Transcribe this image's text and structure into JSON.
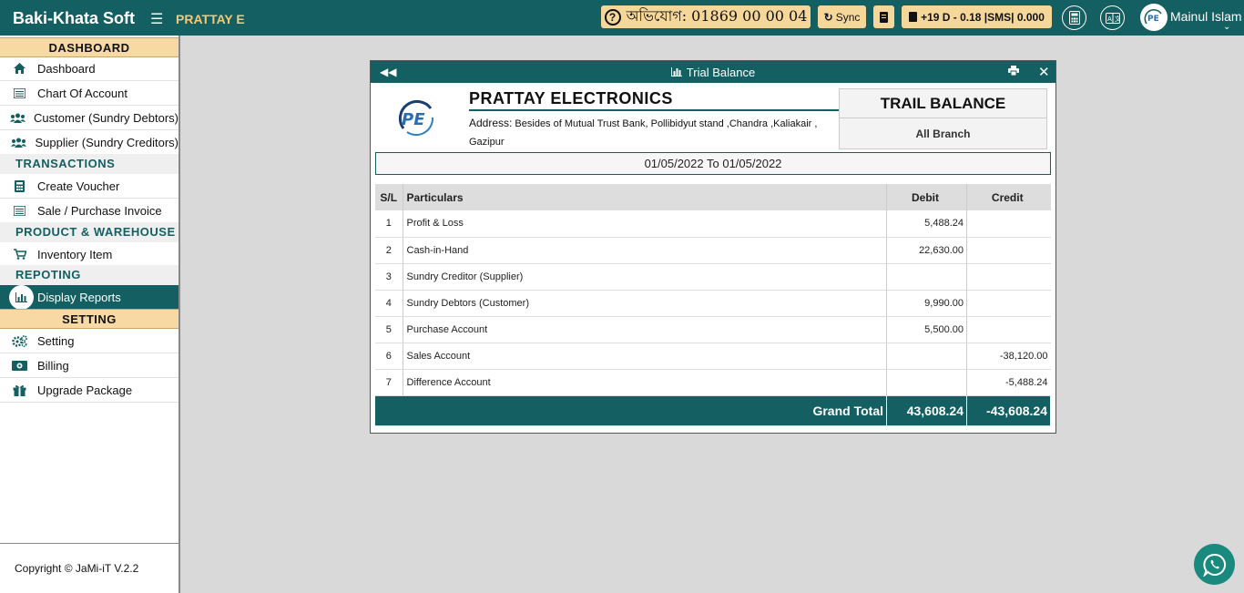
{
  "header": {
    "brand": "Baki-Khata Soft",
    "company_short": "PRATTAY E",
    "complain_text": "অভিযোগ: 01869 00 00 04",
    "sync_label": "Sync",
    "balance_text": "+19 D - 0.18 |SMS| 0.000",
    "username": "Mainul Islam"
  },
  "sidebar": {
    "sections": {
      "dashboard": "DASHBOARD",
      "transactions": "TRANSACTIONS",
      "product": "PRODUCT & WAREHOUSE",
      "reporting": "REPOTING",
      "setting": "SETTING"
    },
    "items": {
      "dashboard": "Dashboard",
      "chart_of_account": "Chart Of Account",
      "customer": "Customer (Sundry Debtors)",
      "supplier": "Supplier (Sundry Creditors)",
      "create_voucher": "Create Voucher",
      "sale_purchase": "Sale / Purchase Invoice",
      "inventory": "Inventory Item",
      "display_reports": "Display Reports",
      "setting": "Setting",
      "billing": "Billing",
      "upgrade": "Upgrade Package"
    },
    "copyright_prefix": "Copyright ©",
    "copyright_brand": "JaMi-iT V.2.2"
  },
  "modal": {
    "title": "Trial Balance",
    "company_name": "PRATTAY ELECTRONICS",
    "address_label": "Address:",
    "address": "Besides of Mutual Trust Bank, Pollibidyut stand ,Chandra ,Kaliakair , Gazipur",
    "report_title": "TRAIL BALANCE",
    "branch": "All Branch",
    "date_range": "01/05/2022 To 01/05/2022",
    "columns": {
      "sl": "S/L",
      "particulars": "Particulars",
      "debit": "Debit",
      "credit": "Credit"
    },
    "rows": [
      {
        "sl": "1",
        "particulars": "Profit & Loss",
        "debit": "5,488.24",
        "credit": ""
      },
      {
        "sl": "2",
        "particulars": "Cash-in-Hand",
        "debit": "22,630.00",
        "credit": ""
      },
      {
        "sl": "3",
        "particulars": "Sundry Creditor (Supplier)",
        "debit": "",
        "credit": ""
      },
      {
        "sl": "4",
        "particulars": "Sundry Debtors (Customer)",
        "debit": "9,990.00",
        "credit": ""
      },
      {
        "sl": "5",
        "particulars": "Purchase Account",
        "debit": "5,500.00",
        "credit": ""
      },
      {
        "sl": "6",
        "particulars": "Sales Account",
        "debit": "",
        "credit": "-38,120.00"
      },
      {
        "sl": "7",
        "particulars": "Difference Account",
        "debit": "",
        "credit": "-5,488.24"
      }
    ],
    "grand_total_label": "Grand Total",
    "grand_total_debit": "43,608.24",
    "grand_total_credit": "-43,608.24"
  },
  "colors": {
    "primary": "#145f61",
    "accent": "#f8d9a4",
    "highlight": "#f7c873"
  }
}
